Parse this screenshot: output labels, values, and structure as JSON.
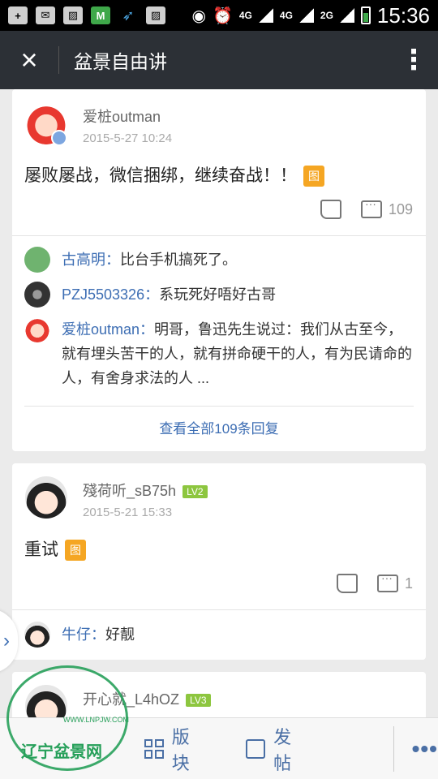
{
  "status_bar": {
    "icons": [
      "plus-icon",
      "mail-icon",
      "image-icon",
      "app-icon",
      "bird-icon",
      "image-icon"
    ],
    "network_1": "4G",
    "network_2": "4G",
    "network_3": "2G",
    "time": "15:36"
  },
  "header": {
    "title": "盆景自由讲",
    "close_icon": "×",
    "more_icon": "⋮"
  },
  "posts": [
    {
      "username": "爱桩outman",
      "timestamp": "2015-5-27 10:24",
      "body": "屡败屡战，微信捆绑，继续奋战！！",
      "image_tag": "图",
      "comment_count": "109",
      "replies": [
        {
          "name": "古高明",
          "sep": "：",
          "text": "比台手机搞死了。"
        },
        {
          "name": "PZJ5503326",
          "sep": "：",
          "text": "系玩死好唔好古哥"
        },
        {
          "name": "爱桩outman",
          "sep": "：",
          "text": "明哥，鲁迅先生说过：我们从古至今，就有埋头苦干的人，就有拼命硬干的人，有为民请命的人，有舍身求法的人 ..."
        }
      ],
      "view_all": "查看全部109条回复"
    },
    {
      "username": "殘荷听_sB75h",
      "level": "LV2",
      "timestamp": "2015-5-21 15:33",
      "body": "重试",
      "image_tag": "图",
      "comment_count": "1",
      "replies": [
        {
          "name": "牛仔",
          "sep": "：",
          "text": "好靓"
        }
      ]
    },
    {
      "username": "开心就_L4hOZ",
      "level": "LV3"
    }
  ],
  "side_arrow": "›",
  "bottom_bar": {
    "blocks_label": "版块",
    "post_label": "发帖",
    "more": "•••"
  },
  "watermark": {
    "url": "WWW.LNPJW.COM",
    "text": "辽宁盆景网"
  },
  "colors": {
    "header_bg": "#2c3036",
    "link_blue": "#3c6db3",
    "tag_orange": "#f5a623",
    "level_green": "#8dc63f"
  }
}
